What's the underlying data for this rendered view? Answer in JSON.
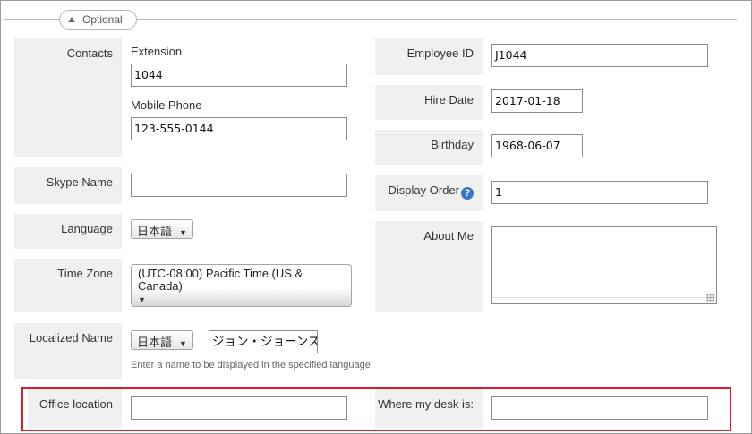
{
  "section": {
    "toggle_label": "Optional"
  },
  "contacts": {
    "label": "Contacts",
    "extension_label": "Extension",
    "extension_value": "1044",
    "mobile_label": "Mobile Phone",
    "mobile_value": "123-555-0144"
  },
  "skype": {
    "label": "Skype Name",
    "value": ""
  },
  "language": {
    "label": "Language",
    "selected": "日本語"
  },
  "timezone": {
    "label": "Time Zone",
    "selected": "(UTC-08:00) Pacific Time (US & Canada)"
  },
  "localized_name": {
    "label": "Localized Name",
    "language_selected": "日本語",
    "value": "ジョン・ジョーンズ",
    "hint": "Enter a name to be displayed in the specified language."
  },
  "office_location": {
    "label": "Office location",
    "value": ""
  },
  "employee_id": {
    "label": "Employee ID",
    "value": "J1044"
  },
  "hire_date": {
    "label": "Hire Date",
    "value": "2017-01-18"
  },
  "birthday": {
    "label": "Birthday",
    "value": "1968-06-07"
  },
  "display_order": {
    "label": "Display Order",
    "value": "1",
    "help_glyph": "?"
  },
  "about_me": {
    "label": "About Me",
    "value": ""
  },
  "desk": {
    "label": "Where my desk is:",
    "value": ""
  },
  "colors": {
    "label_bg": "#f0f0f0",
    "highlight": "#d3202a",
    "help_icon": "#3b73c9"
  }
}
